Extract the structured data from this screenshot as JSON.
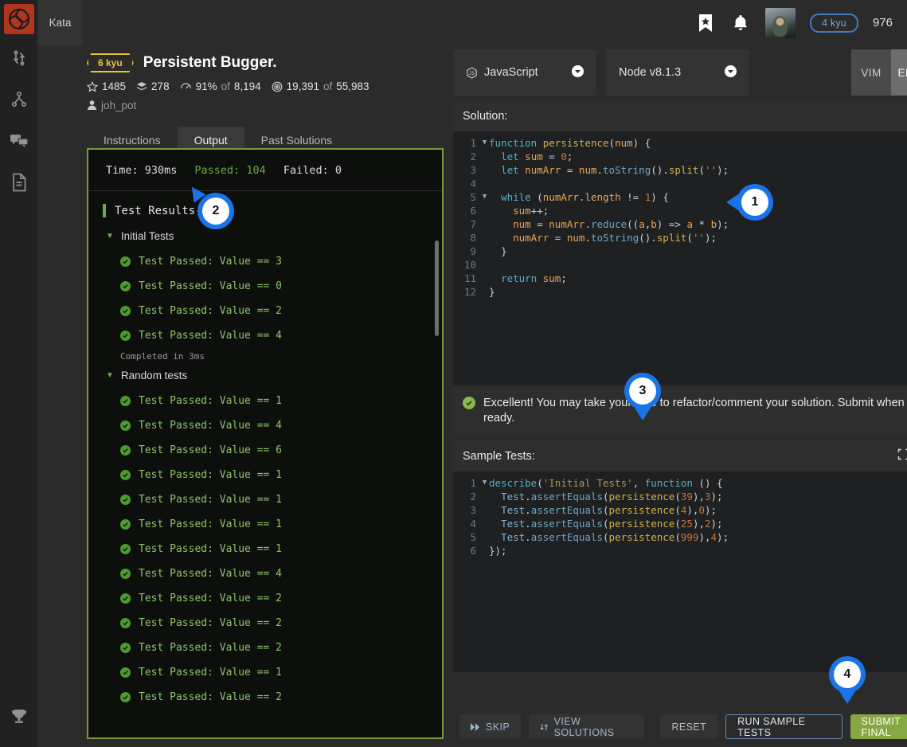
{
  "brand": {
    "logo_icon": "codewars-logo-icon",
    "logo_color": "#b1361e"
  },
  "sidebar": {
    "items": [
      {
        "icon": "sync-icon",
        "name": "sidebar-item-sync"
      },
      {
        "icon": "fork-icon",
        "name": "sidebar-item-fork"
      },
      {
        "icon": "chat-icon",
        "name": "sidebar-item-chat"
      },
      {
        "icon": "document-icon",
        "name": "sidebar-item-docs"
      }
    ],
    "bottom": {
      "icon": "trophy-icon",
      "name": "sidebar-item-trophy"
    }
  },
  "topbar": {
    "kata_tab": "Kata",
    "bookmark_icon": "bookmark-icon",
    "bell_icon": "bell-icon",
    "avatar_alt": "user-avatar",
    "rank_badge": "4 kyu",
    "honor": "976"
  },
  "kata": {
    "rank": "6 kyu",
    "title": "Persistent Bugger.",
    "stats": {
      "stars_icon": "star-icon",
      "stars": "1485",
      "layers_icon": "layers-icon",
      "layers": "278",
      "satisfaction_icon": "gauge-icon",
      "satisfaction": "91%",
      "satisfaction_of": "of",
      "satisfaction_total": "8,194",
      "completed_icon": "target-icon",
      "completed": "19,391",
      "completed_of": "of",
      "completed_total": "55,983",
      "author_icon": "user-icon",
      "author": "joh_pot"
    }
  },
  "tabs": [
    {
      "label": "Instructions",
      "active": false
    },
    {
      "label": "Output",
      "active": true
    },
    {
      "label": "Past Solutions",
      "active": false
    }
  ],
  "output": {
    "border_color": "#7a9b37",
    "time_label": "Time: 930ms",
    "passed_label": "Passed: 104",
    "failed_label": "Failed: 0",
    "results_heading": "Test Results:",
    "groups": [
      {
        "name": "Initial Tests",
        "tests": [
          "Test Passed: Value == 3",
          "Test Passed: Value == 0",
          "Test Passed: Value == 2",
          "Test Passed: Value == 4"
        ],
        "completed": "Completed in 3ms"
      },
      {
        "name": "Random tests",
        "tests": [
          "Test Passed: Value == 1",
          "Test Passed: Value == 4",
          "Test Passed: Value == 6",
          "Test Passed: Value == 1",
          "Test Passed: Value == 1",
          "Test Passed: Value == 1",
          "Test Passed: Value == 1",
          "Test Passed: Value == 4",
          "Test Passed: Value == 2",
          "Test Passed: Value == 2",
          "Test Passed: Value == 2",
          "Test Passed: Value == 1",
          "Test Passed: Value == 2"
        ],
        "completed": ""
      }
    ]
  },
  "language": {
    "language_icon": "js-icon",
    "language_value": "JavaScript",
    "runtime_value": "Node v8.1.3",
    "caret_icon": "chevron-down-icon"
  },
  "editor_mode": {
    "vim": "VIM",
    "emacs": "EMACS",
    "active": "EMACS"
  },
  "solution": {
    "heading": "Solution:",
    "expand_icon": "expand-icon",
    "lines": [
      {
        "n": "1",
        "fold": true,
        "text": "function persistence(num) {"
      },
      {
        "n": "2",
        "fold": false,
        "text": "  let sum = 0;"
      },
      {
        "n": "3",
        "fold": false,
        "text": "  let numArr = num.toString().split('');"
      },
      {
        "n": "4",
        "fold": false,
        "text": ""
      },
      {
        "n": "5",
        "fold": true,
        "text": "  while (numArr.length != 1) {"
      },
      {
        "n": "6",
        "fold": false,
        "text": "    sum++;"
      },
      {
        "n": "7",
        "fold": false,
        "text": "    num = numArr.reduce((a,b) => a * b);"
      },
      {
        "n": "8",
        "fold": false,
        "text": "    numArr = num.toString().split('');"
      },
      {
        "n": "9",
        "fold": false,
        "text": "  }"
      },
      {
        "n": "10",
        "fold": false,
        "text": ""
      },
      {
        "n": "11",
        "fold": false,
        "text": "  return sum;"
      },
      {
        "n": "12",
        "fold": false,
        "text": "}"
      }
    ]
  },
  "notice": {
    "ok_icon": "check-circle-icon",
    "message": "Excellent! You may take your time to refactor/comment your solution. Submit when ready.",
    "close_icon": "close-icon",
    "close_label": "×"
  },
  "sample_tests": {
    "heading": "Sample Tests:",
    "expand_icon": "expand-icon",
    "help_icon": "help-icon",
    "lines": [
      {
        "n": "1",
        "fold": true,
        "text": "describe('Initial Tests', function () {"
      },
      {
        "n": "2",
        "fold": false,
        "text": "  Test.assertEquals(persistence(39),3);"
      },
      {
        "n": "3",
        "fold": false,
        "text": "  Test.assertEquals(persistence(4),0);"
      },
      {
        "n": "4",
        "fold": false,
        "text": "  Test.assertEquals(persistence(25),2);"
      },
      {
        "n": "5",
        "fold": false,
        "text": "  Test.assertEquals(persistence(999),4);"
      },
      {
        "n": "6",
        "fold": false,
        "text": "});"
      }
    ]
  },
  "footer": {
    "skip": "SKIP",
    "skip_icon": "fast-forward-icon",
    "view_solutions": "VIEW SOLUTIONS",
    "view_solutions_icon": "swap-icon",
    "reset": "RESET",
    "run_sample_tests": "RUN SAMPLE TESTS",
    "submit_final": "SUBMIT FINAL",
    "submit_color": "#85a744"
  },
  "markers": [
    {
      "label": "1",
      "tail": "left"
    },
    {
      "label": "2",
      "tail": "upleft"
    },
    {
      "label": "3",
      "tail": "down"
    },
    {
      "label": "4",
      "tail": "down"
    }
  ]
}
